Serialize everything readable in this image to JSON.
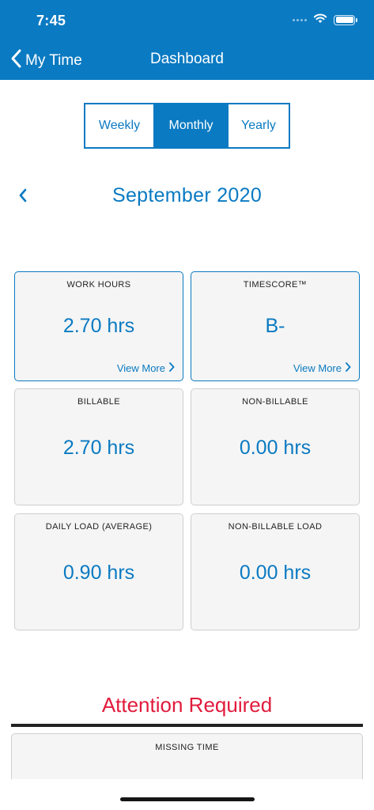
{
  "status": {
    "time": "7:45"
  },
  "nav": {
    "back_label": "My Time",
    "title": "Dashboard"
  },
  "period_tabs": {
    "items": [
      "Weekly",
      "Monthly",
      "Yearly"
    ],
    "selected": "Monthly"
  },
  "month": {
    "label": "September 2020"
  },
  "cards": {
    "work_hours": {
      "title": "WORK HOURS",
      "value": "2.70 hrs",
      "more": "View More"
    },
    "timescore": {
      "title": "TIMESCORE™",
      "value": "B-",
      "more": "View More"
    },
    "billable": {
      "title": "BILLABLE",
      "value": "2.70 hrs"
    },
    "non_billable": {
      "title": "NON-BILLABLE",
      "value": "0.00 hrs"
    },
    "daily_load": {
      "title": "DAILY LOAD (AVERAGE)",
      "value": "0.90 hrs"
    },
    "non_billable_load": {
      "title": "NON-BILLABLE LOAD",
      "value": "0.00 hrs"
    }
  },
  "attention": {
    "heading": "Attention Required",
    "missing_title": "MISSING TIME"
  },
  "colors": {
    "brand": "#0a7ac2",
    "alert": "#e11b3c",
    "card_bg": "#f5f5f5"
  },
  "icons": [
    "wifi-icon",
    "battery-icon",
    "chevron-left-icon",
    "chevron-right-icon"
  ]
}
